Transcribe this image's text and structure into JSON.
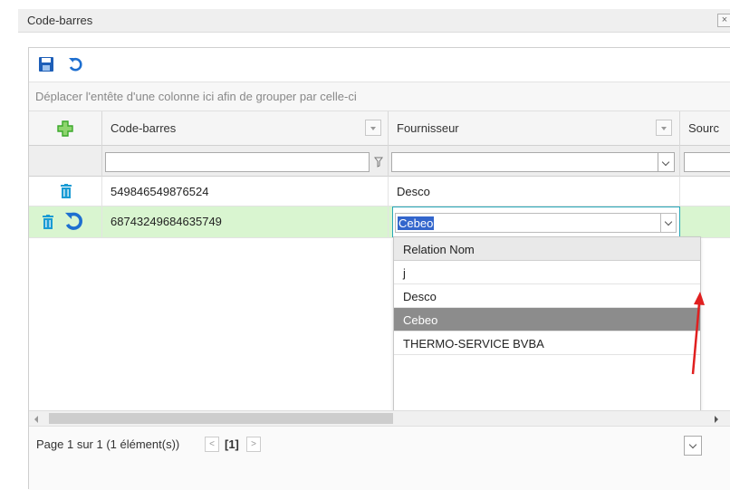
{
  "window": {
    "title": "Code-barres",
    "close_symbol": "×"
  },
  "toolbar": {
    "save_icon": "floppy-disk-icon",
    "undo_icon": "undo-icon"
  },
  "group_hint": "Déplacer l'entête d'une colonne ici afin de grouper par celle-ci",
  "columns": {
    "add_icon": "plus-icon",
    "barcode": "Code-barres",
    "supplier": "Fournisseur",
    "source": "Sourc"
  },
  "rows": [
    {
      "barcode": "549846549876524",
      "supplier": "Desco"
    },
    {
      "barcode": "68743249684635749",
      "supplier": "Cebeo"
    }
  ],
  "editor": {
    "value": "Cebeo"
  },
  "dropdown": {
    "header": "Relation Nom",
    "items": [
      "j",
      "Desco",
      "Cebeo",
      "THERMO-SERVICE BVBA"
    ],
    "active": "Cebeo"
  },
  "pager": {
    "info": "Page 1 sur 1 (1 élément(s))",
    "prev": "<",
    "current": "[1]",
    "next": ">"
  },
  "colors": {
    "accent_blue": "#1e6fd0",
    "add_green": "#3aa82a",
    "trash_teal": "#1a9bd4",
    "selected_row": "#d9f5d0",
    "annotation_red": "#e02020"
  }
}
